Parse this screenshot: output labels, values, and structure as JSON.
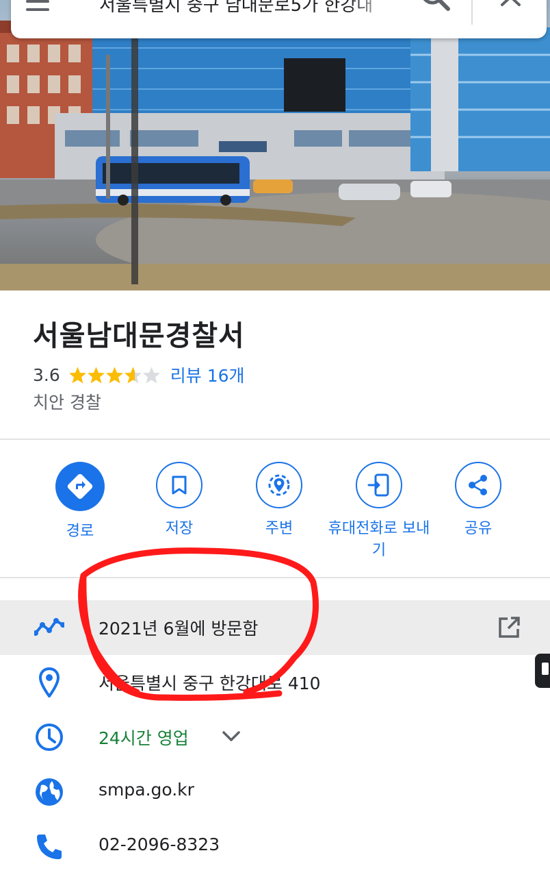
{
  "search": {
    "query": "서울특별시 중구 남대문로5가 한강대"
  },
  "place": {
    "name": "서울남대문경찰서",
    "rating": "3.6",
    "stars": 3.6,
    "reviews": "리뷰 16개",
    "category": "치안 경찰"
  },
  "actions": [
    {
      "label": "경로",
      "icon": "directions-icon"
    },
    {
      "label": "저장",
      "icon": "bookmark-icon"
    },
    {
      "label": "주변",
      "icon": "nearby-icon"
    },
    {
      "label": "휴대전화로 보내기",
      "icon": "send-to-phone-icon"
    },
    {
      "label": "공유",
      "icon": "share-icon"
    }
  ],
  "info": {
    "visited": "2021년 6월에 방문함",
    "address": "서울특별시 중구 한강대로 410",
    "hours": "24시간 영업",
    "website": "smpa.go.kr",
    "phone": "02-2096-8323"
  },
  "colors": {
    "accent": "#1a73e8",
    "open_status": "#188038",
    "star": "#fbbc04",
    "annotation": "#ff1a1a"
  }
}
